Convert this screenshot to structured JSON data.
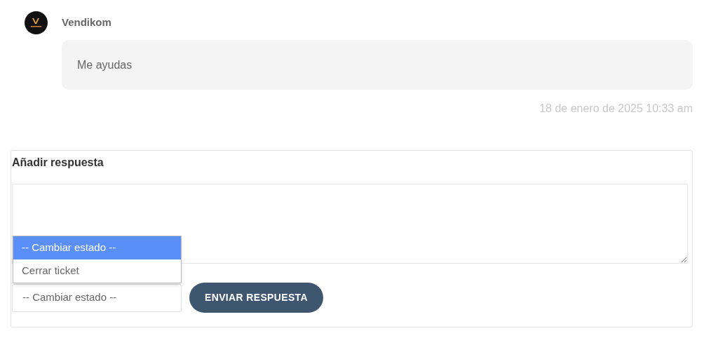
{
  "message": {
    "author": "Vendikom",
    "text": "Me ayudas",
    "timestamp": "18 de enero de 2025 10:33 am"
  },
  "reply_form": {
    "title": "Añadir respuesta",
    "status_select": {
      "value": "-- Cambiar estado --",
      "expanded": true,
      "options": [
        {
          "label": "-- Cambiar estado --",
          "selected": true
        },
        {
          "label": "Cerrar ticket",
          "selected": false
        }
      ]
    },
    "submit_button": "ENVIAR RESPUESTA"
  }
}
